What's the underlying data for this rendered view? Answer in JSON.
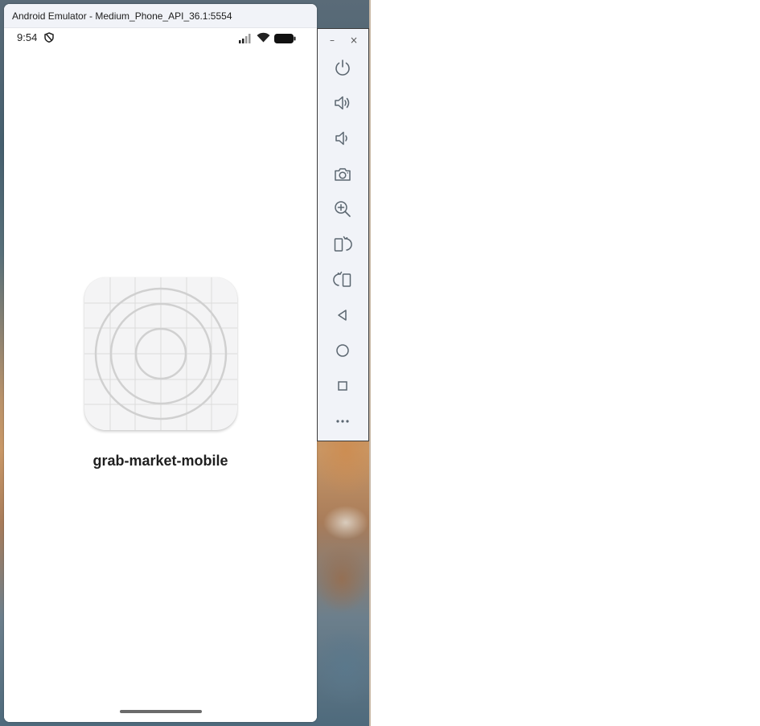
{
  "window": {
    "title": "Android Emulator - Medium_Phone_API_36.1:5554"
  },
  "status_bar": {
    "time": "9:54",
    "icons": [
      "shield-icon",
      "signal-icon",
      "wifi-icon",
      "battery-icon"
    ]
  },
  "home_screen": {
    "app_icon": "app-launcher-icon",
    "app_name": "grab-market-mobile"
  },
  "toolbar": {
    "window_controls": {
      "minimize": "–",
      "close": "×"
    },
    "buttons": [
      {
        "name": "power",
        "icon": "power-icon"
      },
      {
        "name": "volume-up",
        "icon": "volume-up-icon"
      },
      {
        "name": "volume-down",
        "icon": "volume-down-icon"
      },
      {
        "name": "screenshot",
        "icon": "camera-icon"
      },
      {
        "name": "zoom",
        "icon": "zoom-in-icon"
      },
      {
        "name": "rotate-left",
        "icon": "rotate-left-icon"
      },
      {
        "name": "rotate-right",
        "icon": "rotate-right-icon"
      },
      {
        "name": "back",
        "icon": "back-triangle-icon"
      },
      {
        "name": "home",
        "icon": "home-circle-icon"
      },
      {
        "name": "overview",
        "icon": "overview-square-icon"
      },
      {
        "name": "more",
        "icon": "more-icon"
      }
    ]
  },
  "colors": {
    "toolbar_bg": "#f1f3f8",
    "icon_stroke": "#5b6670",
    "title_bar_bg": "#f1f3f8"
  }
}
